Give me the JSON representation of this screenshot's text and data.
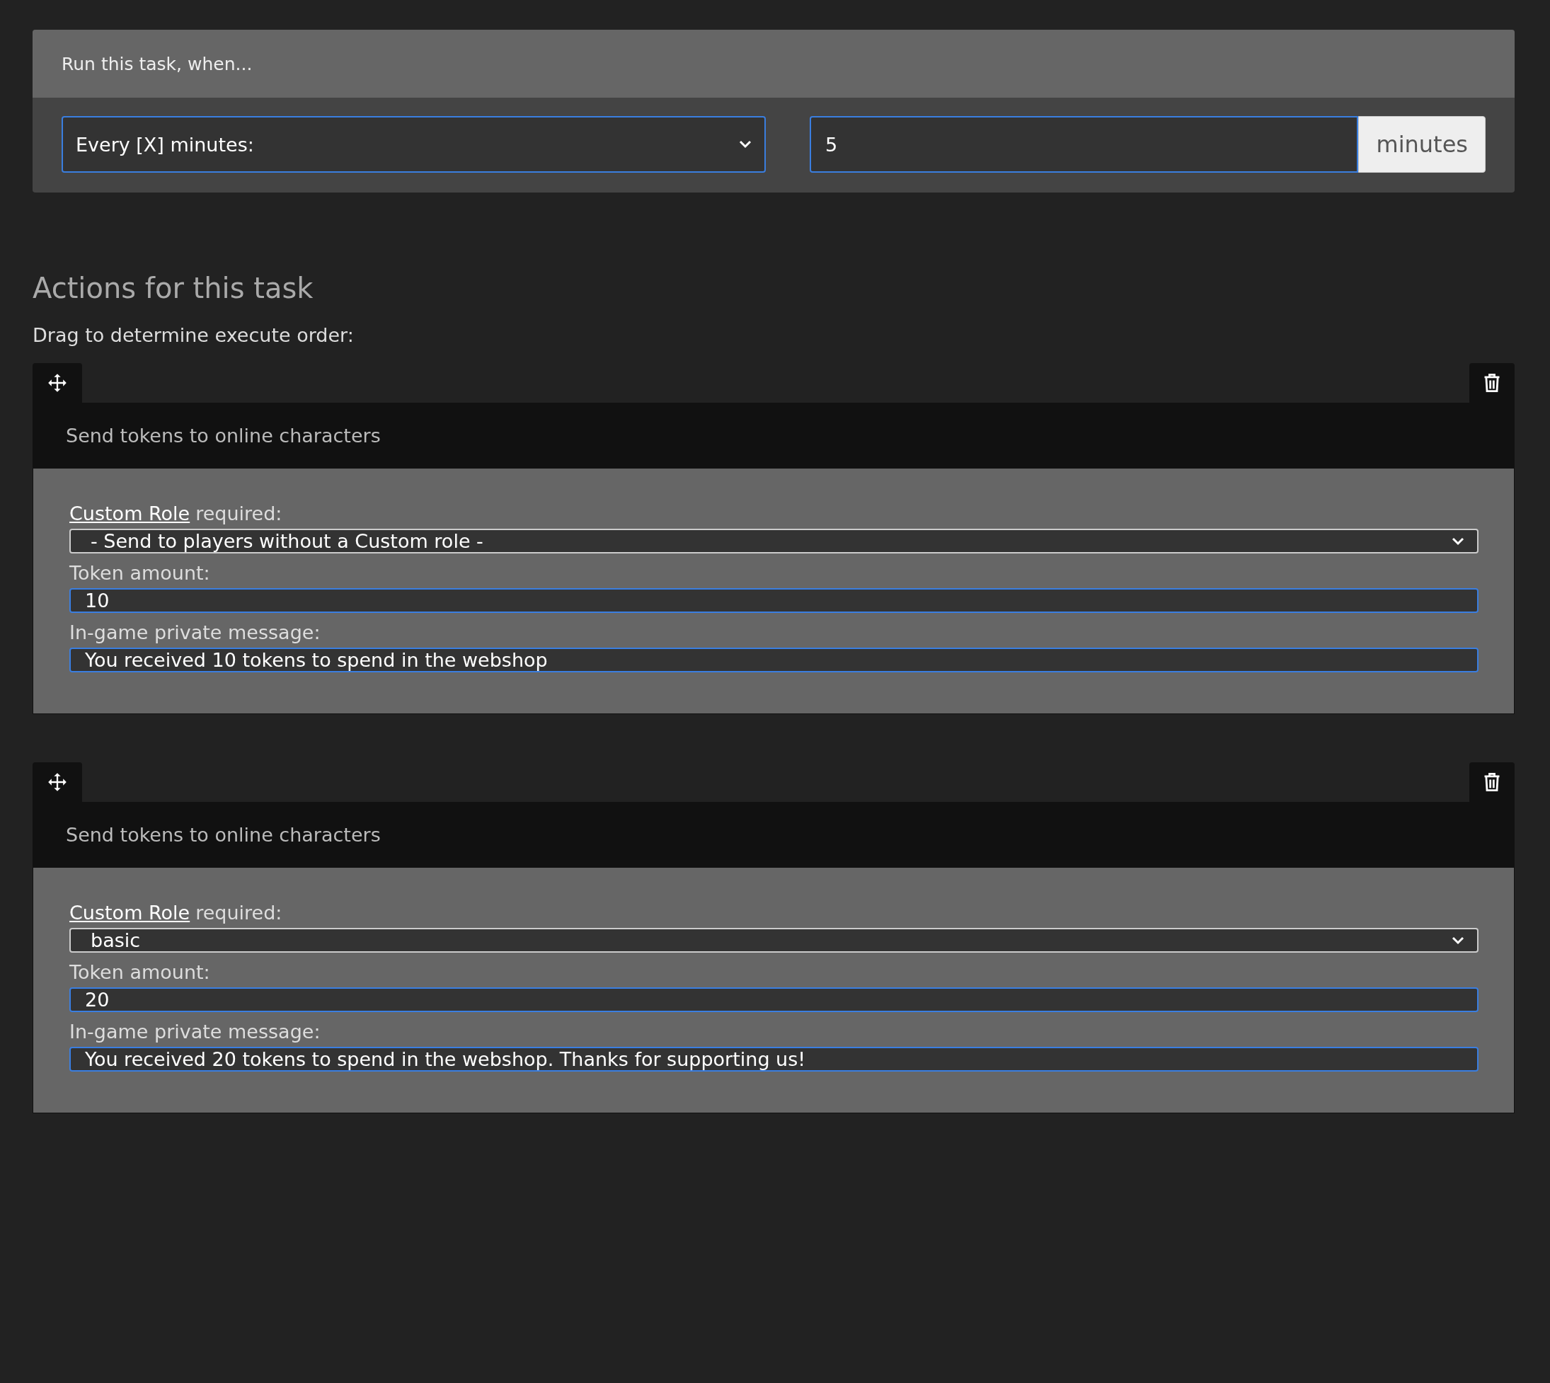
{
  "trigger": {
    "header": "Run this task, when...",
    "schedule": {
      "value": "Every [X] minutes:"
    },
    "interval": {
      "value": "5",
      "unit": "minutes"
    }
  },
  "actions_section": {
    "title": "Actions for this task",
    "hint": "Drag to determine execute order:"
  },
  "actions": [
    {
      "title": "Send tokens to online characters",
      "role": {
        "link": "Custom Role",
        "label": "required:",
        "value": "- Send to players without a Custom role -"
      },
      "amount": {
        "label": "Token amount:",
        "value": "10"
      },
      "message": {
        "label": "In-game private message:",
        "value": "You received 10 tokens to spend in the webshop"
      }
    },
    {
      "title": "Send tokens to online characters",
      "role": {
        "link": "Custom Role",
        "label": "required:",
        "value": "basic"
      },
      "amount": {
        "label": "Token amount:",
        "value": "20"
      },
      "message": {
        "label": "In-game private message:",
        "value": "You received 20 tokens to spend in the webshop. Thanks for supporting us!"
      }
    }
  ]
}
